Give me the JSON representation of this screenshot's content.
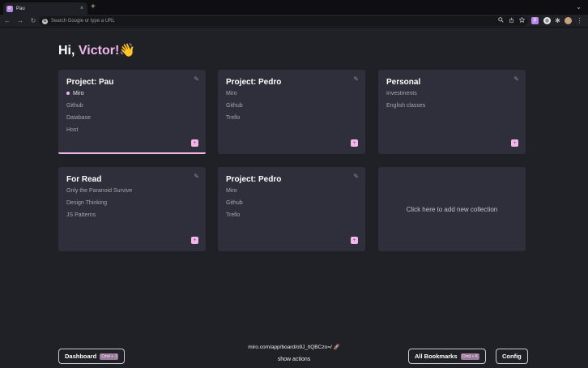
{
  "browser": {
    "tab_title": "Pau",
    "tab_icon_letter": "P",
    "tab_close": "×",
    "new_tab": "+",
    "tabbar_chevron": "⌄",
    "omnibox_placeholder": "Search Google or type a URL",
    "nav": {
      "back": "←",
      "forward": "→",
      "reload": "↻"
    }
  },
  "greeting": {
    "prefix": "Hi, ",
    "name": "Victor!",
    "emoji": "👋"
  },
  "collections": [
    {
      "title": "Project: Pau",
      "items": [
        "Miro",
        "Github",
        "Database",
        "Host"
      ],
      "active_index": 0
    },
    {
      "title": "Project: Pedro",
      "items": [
        "Miro",
        "Github",
        "Trello"
      ]
    },
    {
      "title": "Personal",
      "items": [
        "Investments",
        "English classes"
      ]
    },
    {
      "title": "For Read",
      "items": [
        "Only the Paranoid Survive",
        "Design Thinking",
        "JS Patterns"
      ]
    },
    {
      "title": "Project: Pedro",
      "items": [
        "Miro",
        "Github",
        "Trello"
      ]
    }
  ],
  "add_collection_label": "Click here to add new collection",
  "footer": {
    "dashboard_label": "Dashboard",
    "dashboard_shortcut": "Cmd + J",
    "url": "miro.com/app/board/o9J_ltQBCzo=/",
    "url_emoji": "🚀",
    "actions_label": "show actions",
    "all_bookmarks_label": "All Bookmarks",
    "all_bookmarks_shortcut": "Cmd + K",
    "config_label": "Config"
  },
  "colors": {
    "accent": "#f1b7ea",
    "background": "#202127",
    "card": "#2e2f3a"
  },
  "icons": {
    "edit": "pencil-icon",
    "badge": "collection-badge-icon"
  }
}
